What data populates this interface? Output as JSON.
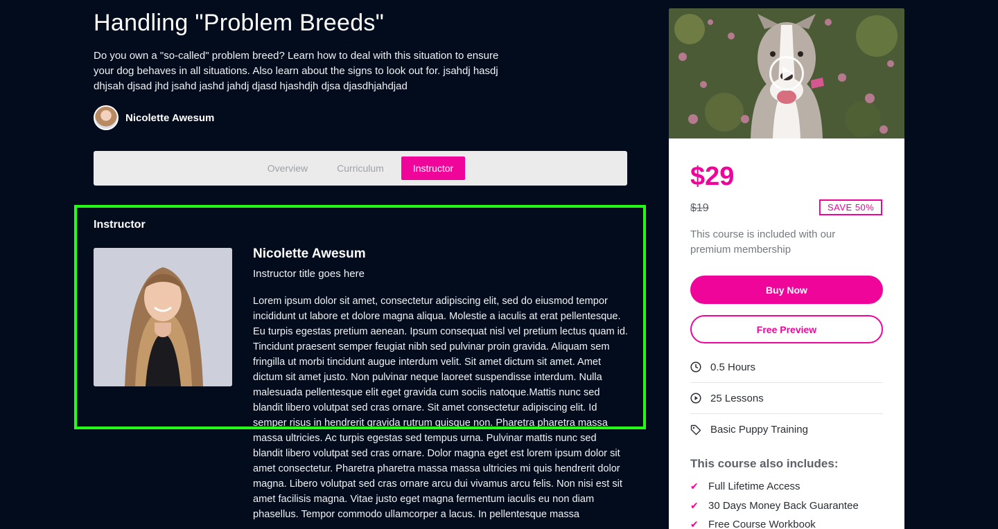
{
  "course": {
    "title": "Handling \"Problem Breeds\"",
    "description": "Do you own a \"so-called\" problem breed? Learn how to deal with this situation to ensure your dog behaves in all situations. Also learn about the signs to look out for. jsahdj hasdj dhjsah djsad jhd jsahd jashd jahdj djasd hjashdjh djsa djasdhjahdjad",
    "author_name": "Nicolette Awesum"
  },
  "tabs": [
    {
      "label": "Overview",
      "active": false
    },
    {
      "label": "Curriculum",
      "active": false
    },
    {
      "label": "Instructor",
      "active": true
    }
  ],
  "instructor": {
    "heading": "Instructor",
    "name": "Nicolette Awesum",
    "title": "Instructor title goes here",
    "bio": "Lorem ipsum dolor sit amet, consectetur adipiscing elit, sed do eiusmod tempor incididunt ut labore et dolore magna aliqua. Molestie a iaculis at erat pellentesque. Eu turpis egestas pretium aenean. Ipsum consequat nisl vel pretium lectus quam id. Tincidunt praesent semper feugiat nibh sed pulvinar proin gravida. Aliquam sem fringilla ut morbi tincidunt augue interdum velit. Sit amet dictum sit amet. Amet dictum sit amet justo. Non pulvinar neque laoreet suspendisse interdum. Nulla malesuada pellentesque elit eget gravida cum sociis natoque.Mattis nunc sed blandit libero volutpat sed cras ornare. Sit amet consectetur adipiscing elit. Id semper risus in hendrerit gravida rutrum quisque non. Pharetra pharetra massa massa ultricies. Ac turpis egestas sed tempus urna. Pulvinar mattis nunc sed blandit libero volutpat sed cras ornare. Dolor magna eget est lorem ipsum dolor sit amet consectetur. Pharetra pharetra massa massa ultricies mi quis hendrerit dolor magna. Libero volutpat sed cras ornare arcu dui vivamus arcu felis. Non nisi est sit amet facilisis magna. Vitae justo eget magna fermentum iaculis eu non diam phasellus. Tempor commodo ullamcorper a lacus. In pellentesque massa"
  },
  "sidebar": {
    "price": "$29",
    "old_price": "$19",
    "save_badge": "SAVE 50%",
    "included_text": "This course is included with our premium membership",
    "buy_label": "Buy Now",
    "preview_label": "Free Preview",
    "meta": [
      {
        "icon": "clock-icon",
        "text": "0.5 Hours"
      },
      {
        "icon": "play-circle-icon",
        "text": "25 Lessons"
      },
      {
        "icon": "tag-icon",
        "text": "Basic Puppy Training"
      }
    ],
    "includes_heading": "This course also includes:",
    "includes": [
      "Full Lifetime Access",
      "30 Days Money Back Guarantee",
      "Free Course Workbook"
    ]
  },
  "colors": {
    "background": "#030c1d",
    "accent": "#f0059a",
    "highlight": "#22ff14",
    "tab_bar": "#ebebeb"
  }
}
